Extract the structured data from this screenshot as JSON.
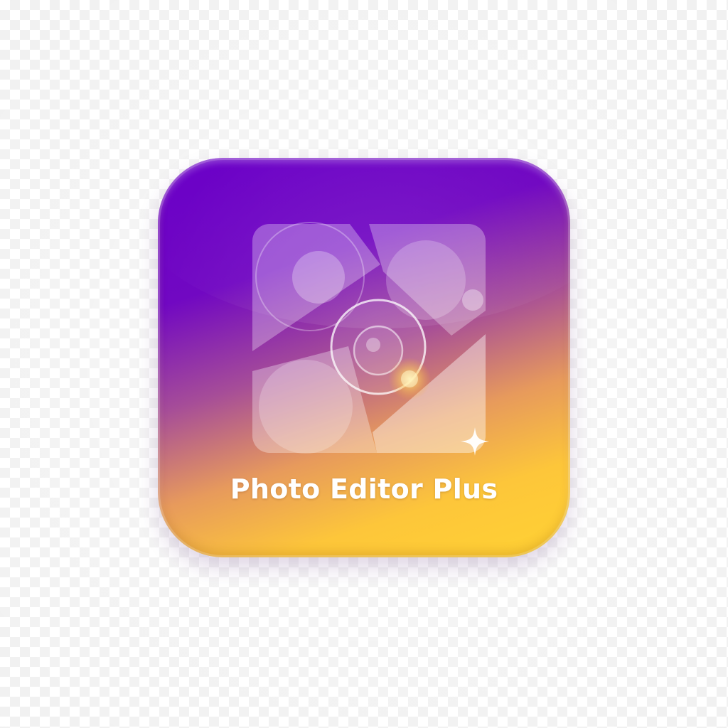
{
  "app_icon": {
    "name": "Photo Editor Plus",
    "glyph_icon": "photo-collage-camera-lens-icon",
    "sparkle_icon": "sparkle-icon"
  },
  "colors": {
    "gradient_top": "#6a00c8",
    "gradient_mid": "#a64d98",
    "gradient_bottom": "#ffd233",
    "text": "#ffffff"
  }
}
